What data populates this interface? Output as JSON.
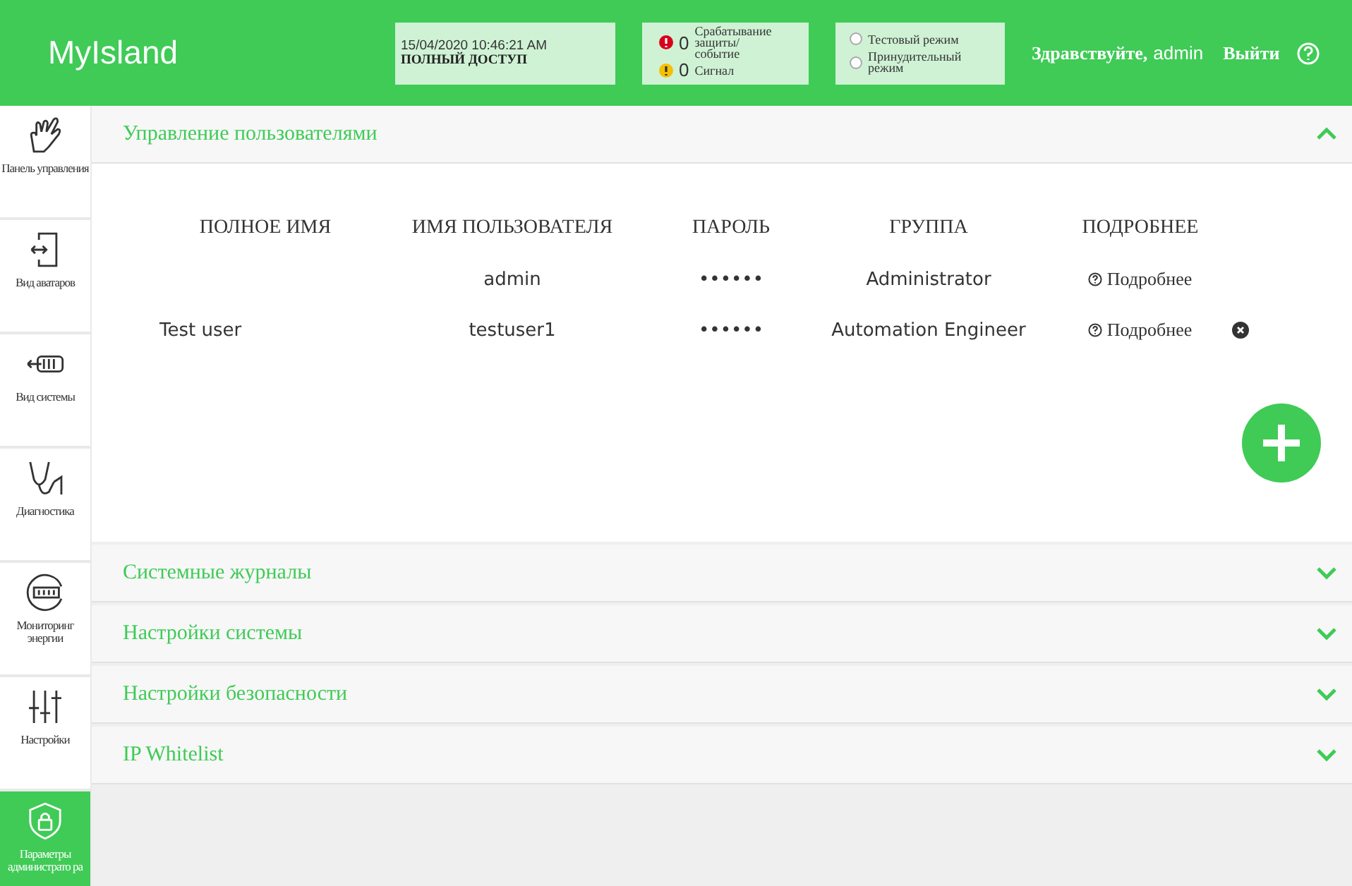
{
  "header": {
    "logo": "MyIsland",
    "datetime": "15/04/2020 10:46:21 AM",
    "access": "ПОЛНЫЙ ДОСТУП",
    "alarms": [
      {
        "kind": "error",
        "count": "0",
        "label": "Срабатывание защиты/событие"
      },
      {
        "kind": "warning",
        "count": "0",
        "label": "Сигнал"
      }
    ],
    "modes": [
      {
        "label": "Тестовый режим",
        "selected": false
      },
      {
        "label": "Принудительный режим",
        "selected": false
      }
    ],
    "greeting": "Здравствуйте,",
    "user": "admin",
    "logout": "Выйти"
  },
  "sidebar": {
    "items": [
      {
        "kind": "hand",
        "label": "Панель управления",
        "selected": false
      },
      {
        "kind": "avatar",
        "label": "Вид аватаров",
        "selected": false
      },
      {
        "kind": "system",
        "label": "Вид системы",
        "selected": false
      },
      {
        "kind": "diagnostics",
        "label": "Диагностика",
        "selected": false
      },
      {
        "kind": "energy",
        "label": "Мониторинг энергии",
        "selected": false
      },
      {
        "kind": "settings",
        "label": "Настройки",
        "selected": false
      },
      {
        "kind": "admin",
        "label": "Параметры администрато ра",
        "selected": true
      }
    ]
  },
  "sections": [
    {
      "title": "Управление пользователями",
      "expanded": true
    },
    {
      "title": "Системные журналы",
      "expanded": false
    },
    {
      "title": "Настройки системы",
      "expanded": false
    },
    {
      "title": "Настройки безопасности",
      "expanded": false
    },
    {
      "title": "IP Whitelist",
      "expanded": false
    }
  ],
  "users_table": {
    "columns": [
      "ПОЛНОЕ ИМЯ",
      "ИМЯ ПОЛЬЗОВАТЕЛЯ",
      "ПАРОЛЬ",
      "ГРУППА",
      "ПОДРОБНЕЕ"
    ],
    "rows": [
      {
        "full_name": "",
        "username": "admin",
        "password": "••••••",
        "group": "Administrator",
        "details": "Подробнее",
        "deletable": false
      },
      {
        "full_name": "Test user",
        "username": "testuser1",
        "password": "••••••",
        "group": "Automation Engineer",
        "details": "Подробнее",
        "deletable": true
      }
    ]
  }
}
